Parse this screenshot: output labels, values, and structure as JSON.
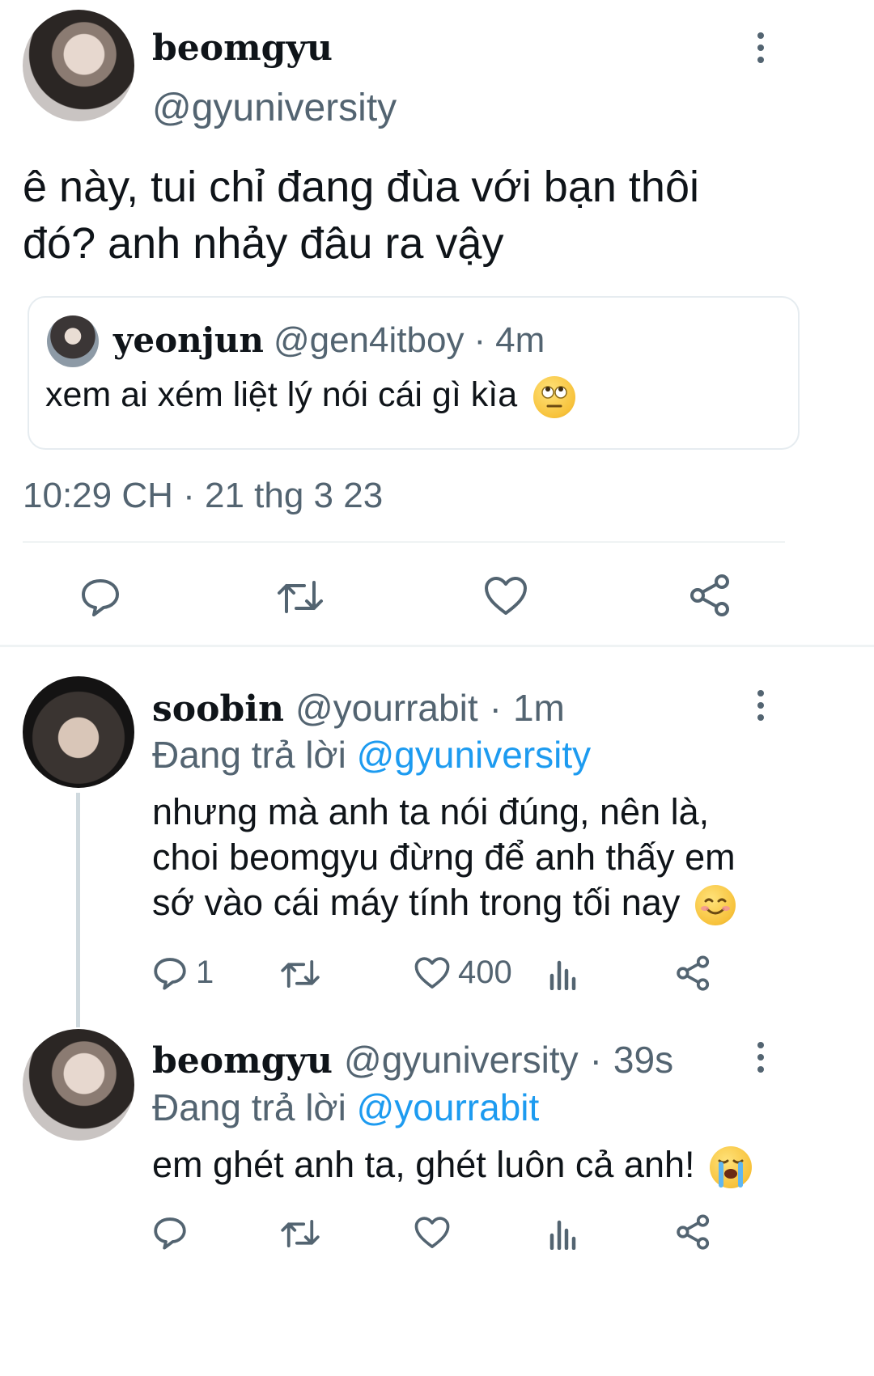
{
  "main_tweet": {
    "name": "beomgyu",
    "handle": "@gyuniversity",
    "text_line1": "ê này, tui chỉ đang đùa với bạn thôi",
    "text_line2": "đó? anh nhảy đâu ra vậy",
    "quote": {
      "name": "yeonjun",
      "handle": "@gen4itboy",
      "sep": "·",
      "time": "4m",
      "text": "xem ai xém liệt lý nói cái gì kìa",
      "emoji": "face-with-rolling-eyes"
    },
    "timestamp": "10:29 CH · 21 thg 3 23"
  },
  "replies": [
    {
      "name": "soobin",
      "handle": "@yourrabit",
      "sep": "·",
      "time": "1m",
      "replying_label": "Đang trả lời",
      "replying_to": "@gyuniversity",
      "line1": "nhưng mà anh ta nói đúng, nên là,",
      "line2": "choi beomgyu đừng để anh thấy em",
      "line3": "sớ vào cái máy tính trong tối nay",
      "emoji": "smiling-face",
      "reply_count": "1",
      "like_count": "400"
    },
    {
      "name": "beomgyu",
      "handle": "@gyuniversity",
      "sep": "·",
      "time": "39s",
      "replying_label": "Đang trả lời",
      "replying_to": "@yourrabit",
      "line1": "em ghét anh ta, ghét luôn cả anh!",
      "emoji": "loudly-crying-face"
    }
  ],
  "colors": {
    "text": "#0f1419",
    "secondary": "#536471",
    "link": "#1d9bf0",
    "divider": "#eff3f4"
  }
}
